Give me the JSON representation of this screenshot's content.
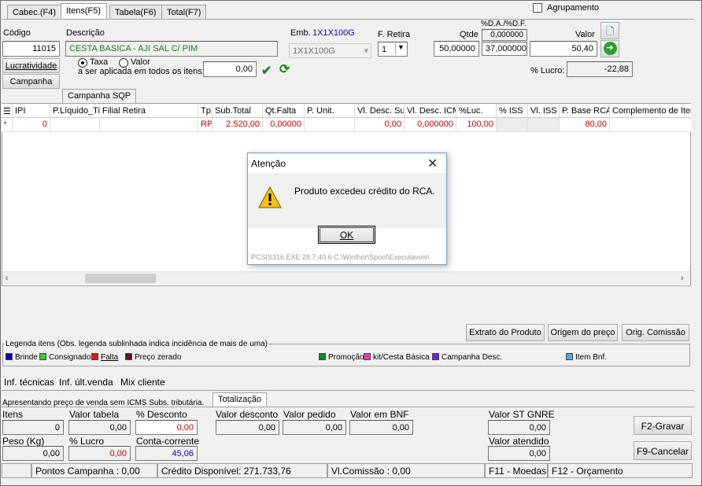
{
  "tabs": [
    "Cabec.(F4)",
    "Itens(F5)",
    "Tabela(F6)",
    "Total(F7)"
  ],
  "agrupamento": {
    "label": "Agrupamento",
    "checked": false
  },
  "form": {
    "codigo_label": "Código",
    "codigo_value": "11015",
    "descricao_label": "Descrição",
    "descricao_value": "CESTA BASICA - AJI SAL C/ PIM",
    "emb_label": "Emb.",
    "emb_value_link": "1X1X100G",
    "emb_select": "1X1X100G",
    "fretira_label": "F. Retira",
    "fretira_value": "1",
    "qtde_label": "Qtde",
    "qtde_value": "50,00000",
    "da_df_label": "%D.A./%D.F.",
    "da_value": "0,000000",
    "df_value": "37,000000",
    "valor_label": "Valor",
    "valor_value": "50,40",
    "lucratividade_btn": "Lucratividade",
    "campanha_btn": "Campanha",
    "taxa_label": "Taxa",
    "valor_radio_label": "Valor",
    "aplicada_label": "a ser aplicada em todos os itens:",
    "taxa_value": "0,00",
    "pct_lucro_label": "% Lucro:",
    "pct_lucro_value": "-22,88",
    "campanha_sqp_tab": "Campanha SQP"
  },
  "grid": {
    "columns": [
      "IPI",
      "P.Líquido_Tr",
      "Filial Retira",
      "Tp.",
      "Sub.Total",
      "Qt.Falta",
      "P. Unit.",
      "Vl. Desc. Su",
      "Vl. Desc. ICM",
      "%Luc.",
      "% ISS",
      "Vl. ISS",
      "P. Base RCA",
      "Complemento de Item"
    ],
    "row": [
      "0",
      "",
      "",
      "RP",
      "2.520,00",
      "0,00000",
      "",
      "0,00",
      "0,000000",
      "100,00",
      "",
      "",
      "80,00",
      ""
    ]
  },
  "buttons": {
    "extrato": "Extrato do Produto",
    "origem_preco": "Origem do preço",
    "orig_comissao": "Orig. Comissão",
    "f2": "F2-Gravar",
    "f9": "F9-Cancelar"
  },
  "legend": {
    "title": "Legenda itens (Obs. legenda sublinhada indica incidência de mais de uma)",
    "items": [
      {
        "label": "Brinde",
        "color": "#0000cc"
      },
      {
        "label": "Consignado",
        "color": "#33cc33"
      },
      {
        "label": "Falta",
        "color": "#ee1111"
      },
      {
        "label": "Preço zerado",
        "color": "#661111"
      },
      {
        "label": "Promoção",
        "color": "#118811"
      },
      {
        "label": "kit/Cesta Básica",
        "color": "#ff33cc"
      },
      {
        "label": "Campanha Desc.",
        "color": "#7722dd"
      },
      {
        "label": "Item Bnf.",
        "color": "#55aaee"
      }
    ]
  },
  "info_links": [
    "Inf. técnicas",
    "Inf. últ.venda",
    "Mix cliente"
  ],
  "bottom": {
    "icms_note": "Apresentando preço de venda sem ICMS Subs. tributária.",
    "totalizacao_tab": "Totalização",
    "itens_label": "Itens",
    "itens_value": "0",
    "valor_tabela_label": "Valor tabela",
    "valor_tabela_value": "0,00",
    "pct_desconto_label": "% Desconto",
    "pct_desconto_value": "0,00",
    "valor_desconto_label": "Valor desconto",
    "valor_desconto_value": "0,00",
    "valor_pedido_label": "Valor pedido",
    "valor_pedido_value": "0,00",
    "valor_bnf_label": "Valor em BNF",
    "valor_bnf_value": "0,00",
    "valor_st_label": "Valor ST GNRE",
    "valor_st_value": "0,00",
    "peso_label": "Peso (Kg)",
    "peso_value": "0,00",
    "pct_lucro_label": "% Lucro",
    "pct_lucro_value": "0,00",
    "conta_label": "Conta-corrente",
    "conta_value": "45,06",
    "valor_atendido_label": "Valor atendido",
    "valor_atendido_value": "0,00"
  },
  "status": {
    "pontos": "Pontos Campanha : 0,00",
    "credito": "Crédito Disponível: 271.733,76",
    "comissao": "Vl.Comissão : 0,00",
    "f11": "F11 - Moedas",
    "f12": "F12 - Orçamento"
  },
  "dialog": {
    "title": "Atenção",
    "message": "Produto excedeu crédito do RCA.",
    "ok": "OK",
    "footer": "PCSIS316.EXE 28.7.40.6 C:\\Winthor\\Spool\\Executaveis\\"
  }
}
